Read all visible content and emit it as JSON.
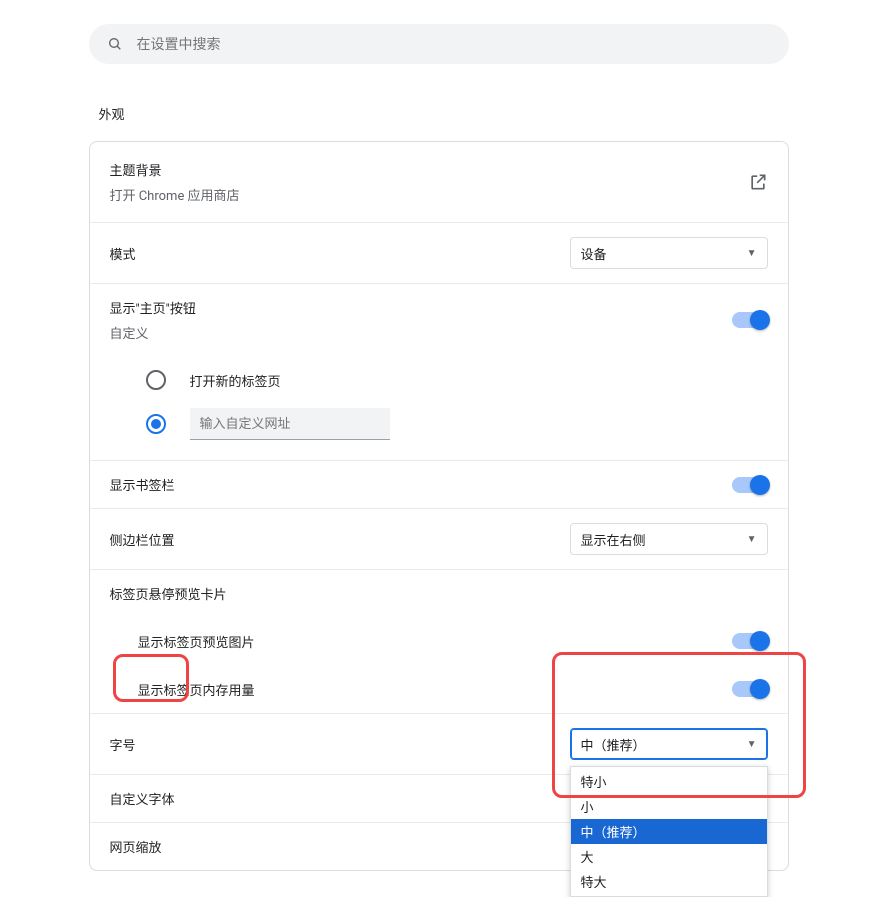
{
  "search": {
    "placeholder": "在设置中搜索"
  },
  "section": {
    "title": "外观"
  },
  "theme": {
    "title": "主题背景",
    "sub": "打开 Chrome 应用商店"
  },
  "mode": {
    "label": "模式",
    "selected": "设备"
  },
  "home_button": {
    "title": "显示\"主页\"按钮",
    "sub": "自定义",
    "radio_newtab": "打开新的标签页",
    "custom_url_placeholder": "输入自定义网址"
  },
  "bookmark_bar": {
    "label": "显示书签栏"
  },
  "sidebar_pos": {
    "label": "侧边栏位置",
    "selected": "显示在右侧"
  },
  "hover_cards": {
    "title": "标签页悬停预览卡片",
    "show_images": "显示标签页预览图片",
    "show_memory": "显示标签页内存用量"
  },
  "font_size": {
    "label": "字号",
    "selected": "中（推荐）",
    "options": [
      "特小",
      "小",
      "中（推荐）",
      "大",
      "特大"
    ],
    "selected_index": 2
  },
  "custom_fonts": {
    "label": "自定义字体"
  },
  "page_zoom": {
    "label": "网页缩放"
  }
}
